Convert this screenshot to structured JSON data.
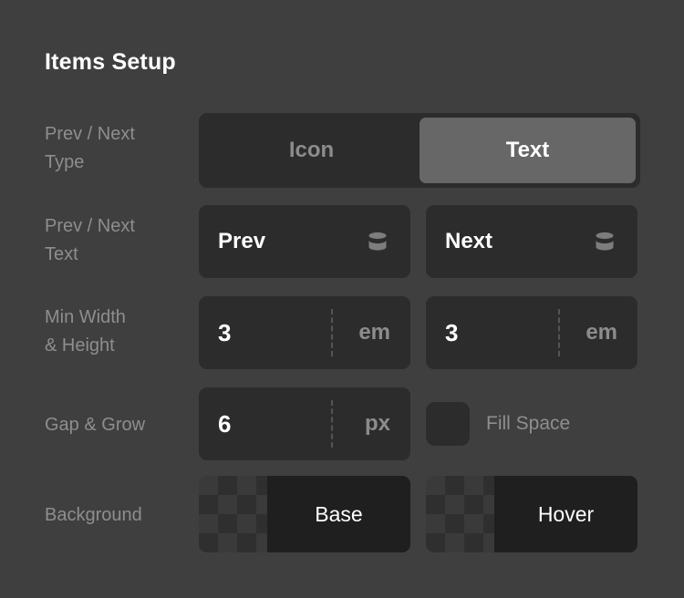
{
  "panel": {
    "title": "Items Setup",
    "background_color": "#3f3f3f"
  },
  "rows": {
    "type": {
      "label": "Prev / Next\nType",
      "label_line1": "Prev / Next",
      "label_line2": "Type",
      "options": [
        {
          "label": "Icon",
          "selected": false
        },
        {
          "label": "Text",
          "selected": true
        }
      ],
      "selected_value": "Text",
      "selected_color": "#676767"
    },
    "text": {
      "label_line1": "Prev / Next",
      "label_line2": "Text",
      "prev": {
        "value": "Prev",
        "icon": "database-icon"
      },
      "next": {
        "value": "Next",
        "icon": "database-icon"
      }
    },
    "minsize": {
      "label_line1": "Min Width",
      "label_line2": "& Height",
      "width": {
        "value": "3",
        "unit": "em"
      },
      "height": {
        "value": "3",
        "unit": "em"
      }
    },
    "gapgrow": {
      "label": "Gap & Grow",
      "gap": {
        "value": "6",
        "unit": "px"
      },
      "grow": {
        "label": "Fill Space",
        "checked": false
      }
    },
    "background": {
      "label": "Background",
      "base": {
        "label": "Base",
        "color": "#1f1f1f"
      },
      "hover": {
        "label": "Hover",
        "color": "#1f1f1f"
      }
    }
  }
}
